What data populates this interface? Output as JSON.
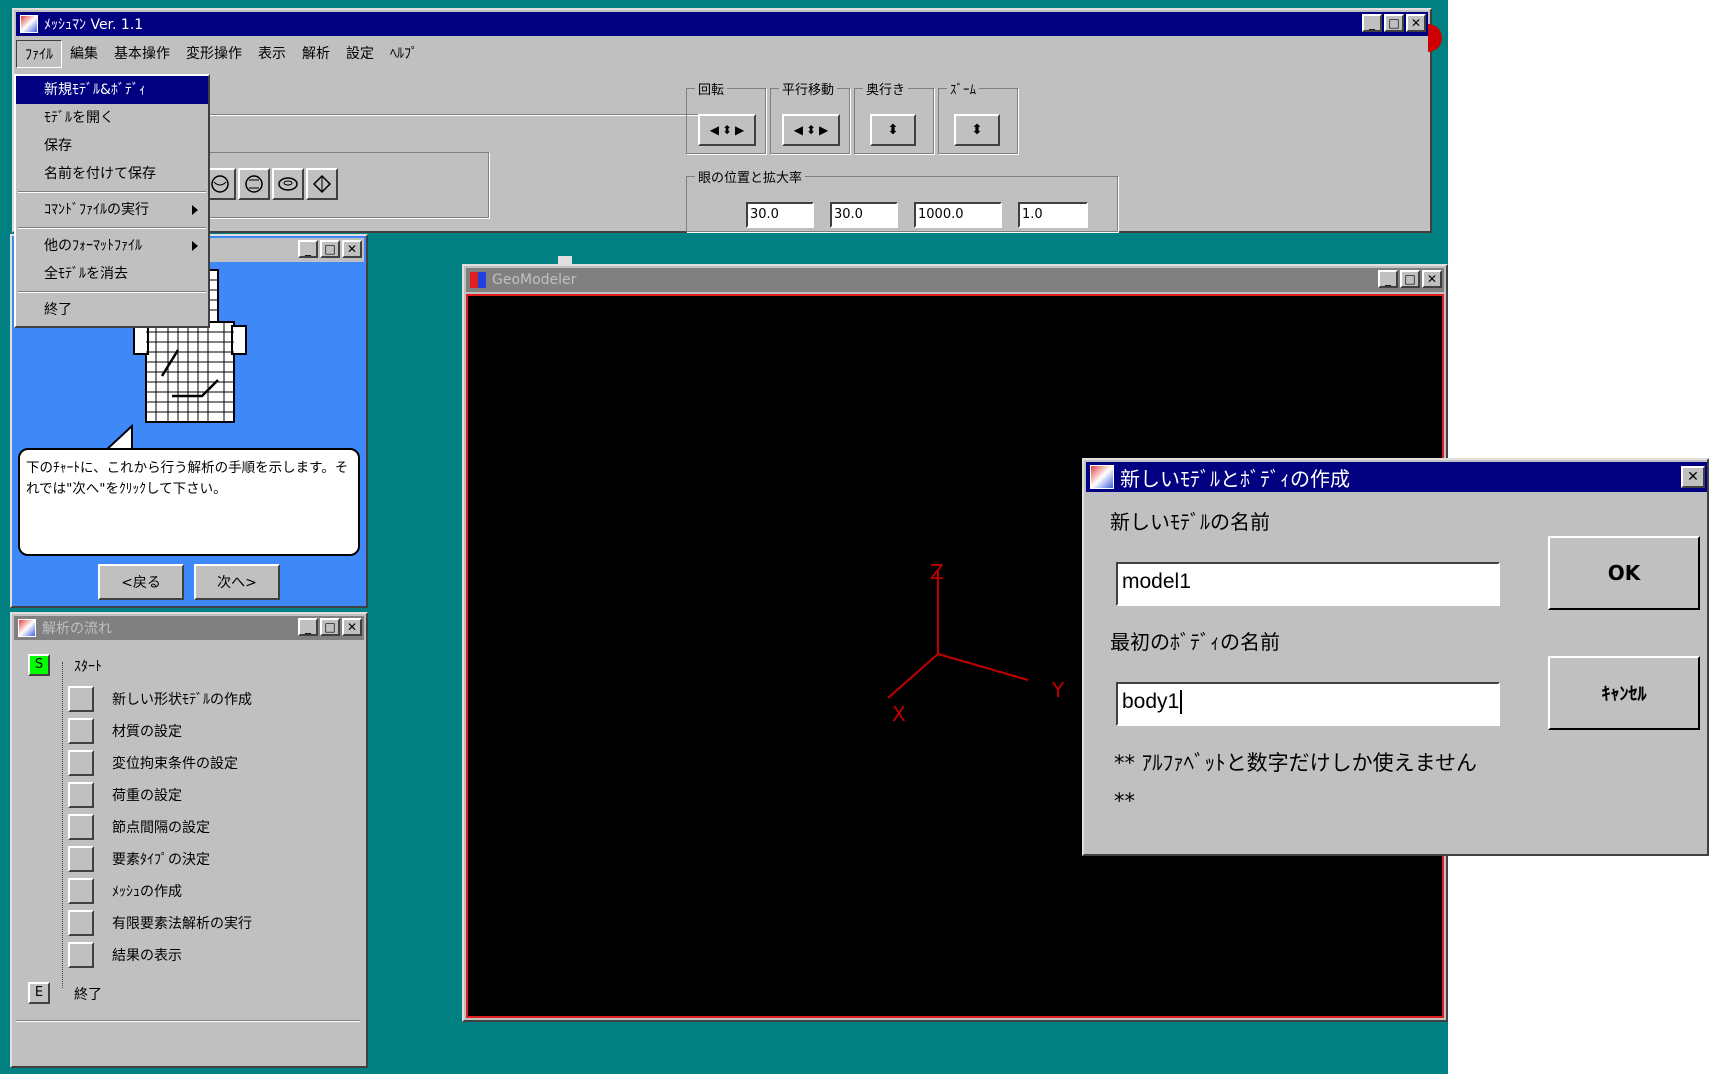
{
  "main_window": {
    "title": "ﾒｯｼｭﾏﾝ Ver. 1.1",
    "menu": [
      "ﾌｧｲﾙ",
      "編集",
      "基本操作",
      "変形操作",
      "表示",
      "解析",
      "設定",
      "ﾍﾙﾌﾟ"
    ]
  },
  "file_menu": {
    "items": [
      {
        "label": "新規ﾓﾃﾞﾙ&ﾎﾞﾃﾞｨ",
        "highlighted": true
      },
      {
        "label": "ﾓﾃﾞﾙを開く"
      },
      {
        "label": "保存"
      },
      {
        "label": "名前を付けて保存"
      },
      {
        "label": "ｺﾏﾝﾄﾞﾌｧｲﾙの実行",
        "submenu": true
      },
      {
        "label": "他のﾌｫｰﾏｯﾄﾌｧｲﾙ",
        "submenu": true
      },
      {
        "label": "全ﾓﾃﾞﾙを消去"
      },
      {
        "label": "終了"
      }
    ]
  },
  "view_controls": {
    "rotate_label": "回転",
    "translate_label": "平行移動",
    "depth_label": "奥行き",
    "zoom_label": "ｽﾞｰﾑ",
    "eye_label": "眼の位置と拡大率",
    "values": [
      "30.0",
      "30.0",
      "1000.0",
      "1.0"
    ]
  },
  "guide_window": {
    "message": "下のﾁｬｰﾄに、これから行う解析の手順を示します。それでは\"次へ\"をｸﾘｯｸして下さい。",
    "back_button": "<戻る",
    "next_button": "次へ>"
  },
  "flow_window": {
    "title": "解析の流れ",
    "start_badge": "S",
    "start_label": "ｽﾀｰﾄ",
    "steps": [
      "新しい形状ﾓﾃﾞﾙの作成",
      "材質の設定",
      "変位拘束条件の設定",
      "荷重の設定",
      "節点間隔の設定",
      "要素ﾀｲﾌﾟの決定",
      "ﾒｯｼｭの作成",
      "有限要素法解析の実行",
      "結果の表示"
    ],
    "end_badge": "E",
    "end_label": "終了"
  },
  "geomodeler": {
    "title": "GeoModeler",
    "axis_x": "X",
    "axis_y": "Y",
    "axis_z": "Z"
  },
  "dialog": {
    "title": "新しいﾓﾃﾞﾙとﾎﾞﾃﾞｨの作成",
    "model_label": "新しいﾓﾃﾞﾙの名前",
    "model_value": "model1",
    "body_label": "最初のﾎﾞﾃﾞｨの名前",
    "body_value": "body1",
    "note": "** ｱﾙﾌｧﾍﾞｯﾄと数字だけしか使えません **",
    "ok_button": "OK",
    "cancel_button": "ｷｬﾝｾﾙ"
  },
  "colors": {
    "desktop": "#008080",
    "titlebar_active": "#000080",
    "titlebar_inactive": "#808080",
    "guide_bg": "#3f88f8",
    "axis": "#c00000",
    "canvas_border": "#e02020"
  }
}
